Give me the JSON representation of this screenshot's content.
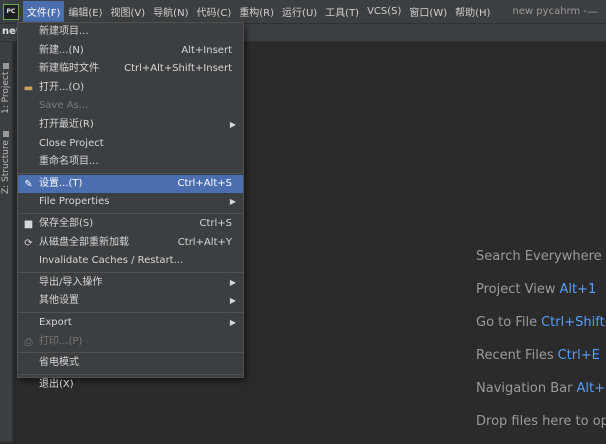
{
  "app_logo": "PC",
  "menubar": {
    "items": [
      "文件(F)",
      "编辑(E)",
      "视图(V)",
      "导航(N)",
      "代码(C)",
      "重构(R)",
      "运行(U)",
      "工具(T)",
      "VCS(S)",
      "窗口(W)",
      "帮助(H)"
    ],
    "project_title": "new pycahrm -",
    "window_control": "—"
  },
  "navbar": {
    "project": "new"
  },
  "sidebar": {
    "tabs": [
      "1: Project",
      "Z: Structure"
    ]
  },
  "file_menu": {
    "items": [
      {
        "label": "新建项目...",
        "shortcut": ""
      },
      {
        "label": "新建...(N)",
        "shortcut": "Alt+Insert"
      },
      {
        "label": "新建临时文件",
        "shortcut": "Ctrl+Alt+Shift+Insert"
      },
      {
        "label": "打开...(O)",
        "shortcut": "",
        "icon": "folder-icon"
      },
      {
        "label": "Save As...",
        "shortcut": ""
      },
      {
        "label": "打开最近(R)",
        "shortcut": "",
        "submenu": true
      },
      {
        "label": "Close Project",
        "shortcut": ""
      },
      {
        "label": "重命名项目...",
        "shortcut": ""
      },
      {
        "label": "设置...(T)",
        "shortcut": "Ctrl+Alt+S",
        "icon": "wrench-icon"
      },
      {
        "label": "File Properties",
        "shortcut": "",
        "submenu": true
      },
      {
        "label": "保存全部(S)",
        "shortcut": "Ctrl+S",
        "icon": "save-icon"
      },
      {
        "label": "从磁盘全部重新加载",
        "shortcut": "Ctrl+Alt+Y",
        "icon": "sync-icon"
      },
      {
        "label": "Invalidate Caches / Restart...",
        "shortcut": ""
      },
      {
        "label": "导出/导入操作",
        "shortcut": "",
        "submenu": true
      },
      {
        "label": "其他设置",
        "shortcut": "",
        "submenu": true
      },
      {
        "label": "Export",
        "shortcut": "",
        "submenu": true
      },
      {
        "label": "打印...(P)",
        "shortcut": "",
        "icon": "print-icon"
      },
      {
        "label": "省电模式",
        "shortcut": ""
      },
      {
        "label": "退出(X)",
        "shortcut": ""
      }
    ],
    "submenu_arrow": "▶",
    "icons": {
      "folder": "▬",
      "wrench": "✎",
      "save": "■",
      "sync": "⟳",
      "print": "⎙"
    }
  },
  "hints": [
    {
      "text": "Search Everywhere",
      "key": ""
    },
    {
      "text": "Project View",
      "key": "Alt+1"
    },
    {
      "text": "Go to File",
      "key": "Ctrl+Shift"
    },
    {
      "text": "Recent Files",
      "key": "Ctrl+E"
    },
    {
      "text": "Navigation Bar",
      "key": "Alt+"
    },
    {
      "text": "Drop files here to op",
      "key": ""
    }
  ],
  "colors": {
    "accent": "#4b6eaf",
    "shortcut_key": "#589df6",
    "background": "#2b2b2b"
  }
}
